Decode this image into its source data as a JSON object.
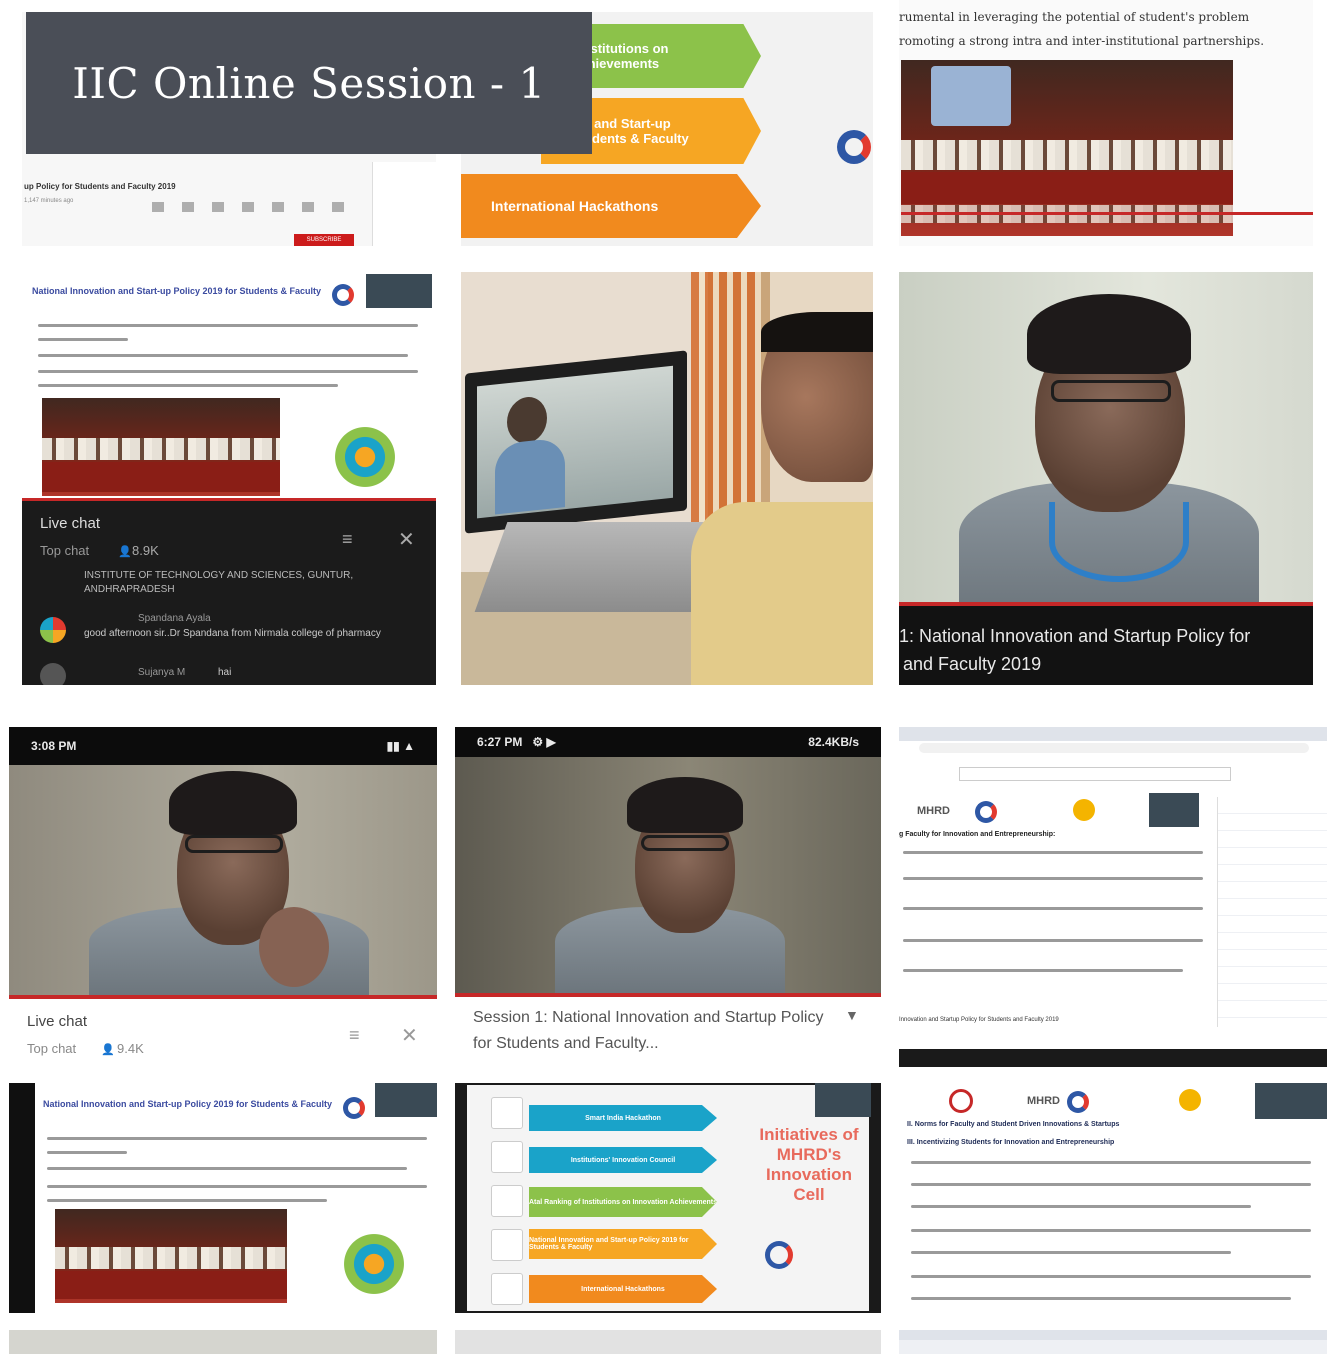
{
  "banner": {
    "title": "IIC Online Session - 1"
  },
  "tile1": {
    "video_title": "up Policy for Students and Faculty 2019",
    "meta": "1,147 minutes ago",
    "subscribe": "SUBSCRIBE"
  },
  "tile2": {
    "arrow1": "f Institutions on\nAchievements",
    "arrow2": "ion and Start-up\nStudents & Faculty",
    "arrow3": "International Hackathons"
  },
  "tile3": {
    "text_line1": "rumental in leveraging the potential of student's problem",
    "text_line2": "romoting a strong intra and inter-institutional partnerships."
  },
  "tile4": {
    "slide_title": "National Innovation and Start-up Policy 2019 for Students & Faculty",
    "chat_header": "Live chat",
    "chat_sub": "Top chat",
    "chat_count": "8.9K",
    "msg0": "INSTITUTE OF TECHNOLOGY AND SCIENCES, GUNTUR, ANDHRAPRADESH",
    "msg1_name": "Spandana Ayala",
    "msg1_text": "good afternoon sir..Dr Spandana from Nirmala college of pharmacy",
    "msg2_name": "Sujanya M",
    "msg2_text": "hai"
  },
  "tile6": {
    "caption_line1": "1: National Innovation and Startup Policy for",
    "caption_line2": "and Faculty 2019"
  },
  "tile7": {
    "time": "3:08 PM",
    "chat_header": "Live chat",
    "chat_sub": "Top chat",
    "chat_count": "9.4K"
  },
  "tile8": {
    "time": "6:27 PM",
    "speed": "82.4KB/s",
    "caption": "Session 1: National Innovation and Startup Policy for Students and Faculty..."
  },
  "tile9": {
    "brand": "MHRD",
    "heading": "g Faculty for Innovation and Entrepreneurship:",
    "footer": "Innovation and Startup Policy for Students and Faculty 2019"
  },
  "tile10": {
    "slide_title": "National Innovation and Start-up Policy 2019 for Students & Faculty"
  },
  "tile11": {
    "items": [
      "Smart India Hackathon",
      "Institutions' Innovation Council",
      "Atal Ranking of Institutions on Innovation Achievements",
      "National Innovation and Start-up Policy 2019 for Students & Faculty",
      "International Hackathons"
    ],
    "side_title": "Initiatives of MHRD's Innovation Cell"
  },
  "tile12": {
    "brand": "MHRD",
    "heading1": "II. Norms for Faculty and Student Driven Innovations & Startups",
    "heading2": "III. Incentivizing Students for Innovation and Entrepreneurship"
  },
  "colors": {
    "banner_bg": "#4a4e57",
    "green": "#8cc24a",
    "orange": "#f6a623",
    "orange_dark": "#f18a1e",
    "teal": "#1aa3c9",
    "red": "#c62828"
  }
}
